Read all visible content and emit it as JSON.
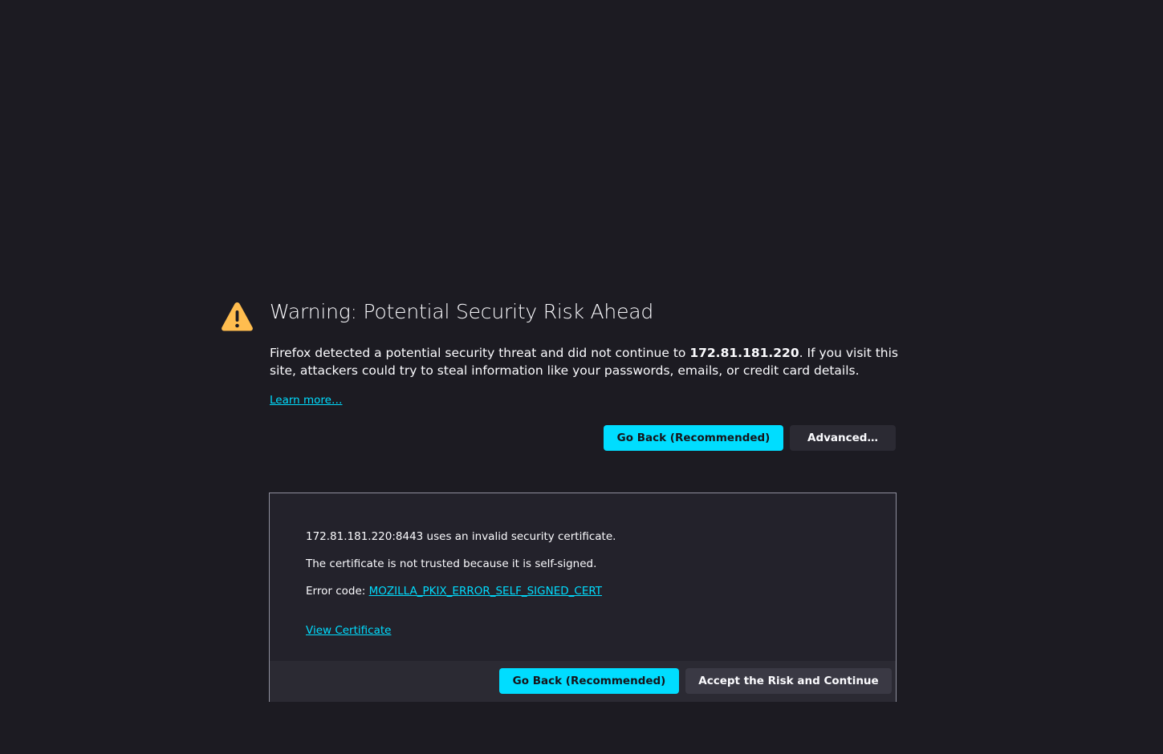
{
  "title": "Warning: Potential Security Risk Ahead",
  "description": {
    "before": "Firefox detected a potential security threat and did not continue to ",
    "host": "172.81.181.220",
    "after": ". If you visit this site, attackers could try to steal information like your passwords, emails, or credit card details."
  },
  "learn_more": "Learn more…",
  "buttons": {
    "go_back": "Go Back (Recommended)",
    "advanced": "Advanced…",
    "accept": "Accept the Risk and Continue"
  },
  "advanced_panel": {
    "line1": "172.81.181.220:8443 uses an invalid security certificate.",
    "line2": "The certificate is not trusted because it is self-signed.",
    "error_label": "Error code: ",
    "error_code": "MOZILLA_PKIX_ERROR_SELF_SIGNED_CERT",
    "view_certificate": "View Certificate"
  },
  "colors": {
    "background": "#1c1b22",
    "accent": "#00ddff",
    "warning": "#ffbd4f"
  },
  "icons": {
    "warning": "warning-triangle-icon"
  }
}
